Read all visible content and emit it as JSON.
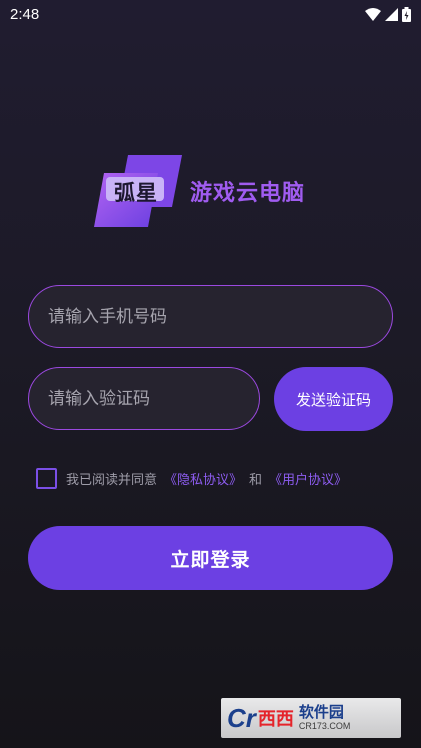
{
  "status_bar": {
    "time": "2:48",
    "icons": [
      "wifi-icon",
      "signal-icon",
      "battery-icon"
    ]
  },
  "logo": {
    "badge_text": "弧星",
    "title": "游戏云电脑"
  },
  "form": {
    "phone_placeholder": "请输入手机号码",
    "phone_value": "",
    "code_placeholder": "请输入验证码",
    "code_value": "",
    "send_code_label": "发送验证码"
  },
  "agreement": {
    "checked": false,
    "prefix": "我已阅读并同意",
    "privacy_link": "《隐私协议》",
    "conjunction": "和",
    "user_link": "《用户协议》"
  },
  "login_button": "立即登录",
  "watermark": {
    "logo_c": "Cr",
    "logo_red": "西西",
    "title": "软件园",
    "sub": "CR173.COM"
  },
  "colors": {
    "accent": "#6c40e3",
    "border": "#9b49e0",
    "title": "#a05cf0",
    "background": "#1c1a26"
  }
}
